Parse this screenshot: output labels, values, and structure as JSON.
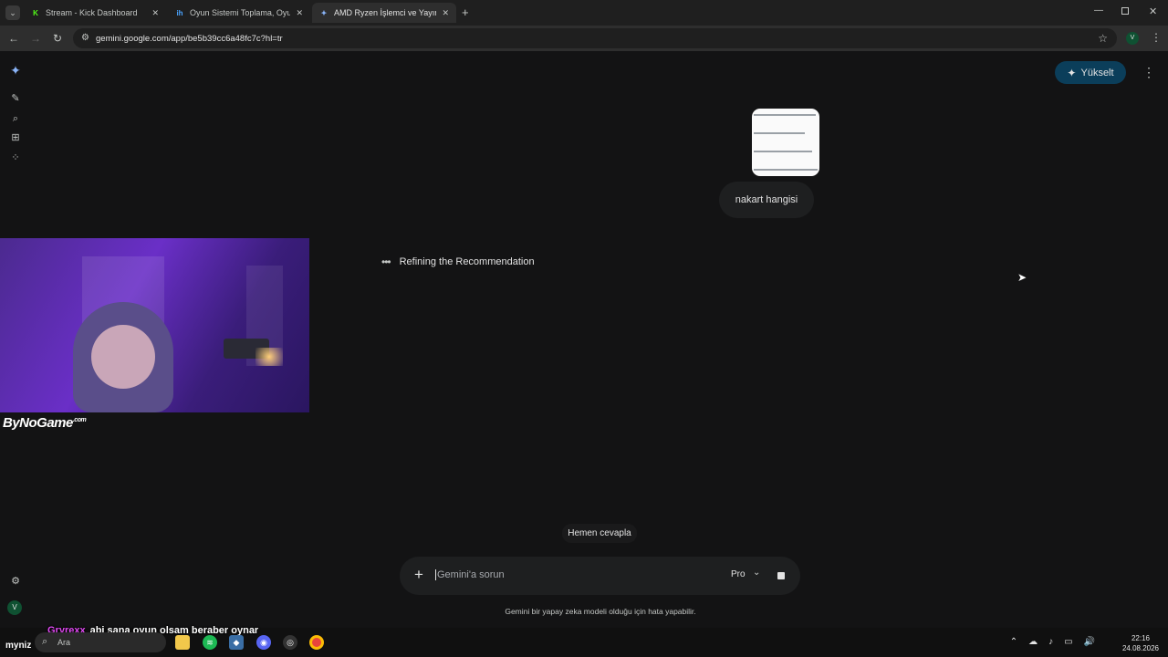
{
  "browser": {
    "tabs": [
      {
        "title": "Stream - Kick Dashboard",
        "favicon": "K",
        "favicon_color": "#53fc18",
        "active": false
      },
      {
        "title": "Oyun Sistemi Toplama, Oyuna G",
        "favicon": "ih",
        "favicon_color": "#4aa3ff",
        "active": false
      },
      {
        "title": "AMD Ryzen İşlemci ve Yayın Pe",
        "favicon": "gemini-icon",
        "favicon_color": "#8ab4f8",
        "active": true
      }
    ],
    "url": "gemini.google.com/app/be5b39cc6a48fc7c?hl=tr",
    "profile_initial": "V"
  },
  "gemini": {
    "upgrade_label": "Yükselt",
    "user_message": "nakart hangisi",
    "thinking_label": "Refining the Recommendation",
    "suggestion_chip": "Hemen cevapla",
    "prompt_placeholder": "Gemini'a sorun",
    "model_label": "Pro",
    "disclaimer": "Gemini bir yapay zeka modeli olduğu için hata yapabilir.",
    "avatar_initial": "V"
  },
  "overlay": {
    "brand": "ByNoGame",
    "brand_suffix": ".com",
    "chat_user": "Gryrexx",
    "chat_message": "abi sana oyun olsam beraber oynar",
    "chat_tag": "myniz"
  },
  "taskbar": {
    "search_label": "Ara",
    "time": "22:16",
    "date": "24.08.2026"
  },
  "colors": {
    "background": "#131314",
    "accent": "#0b3e5a",
    "chat_user": "#e049f2"
  }
}
